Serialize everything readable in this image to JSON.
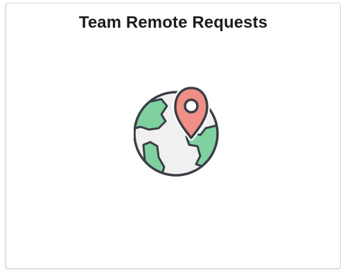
{
  "tile": {
    "title": "Team Remote Requests",
    "icon": "globe-location-pin-icon"
  },
  "colors": {
    "title": "#1c1c1c",
    "globe_fill": "#f0f0f0",
    "land": "#7fd2a0",
    "pin": "#ef8f86",
    "outline": "#3a3f45"
  }
}
